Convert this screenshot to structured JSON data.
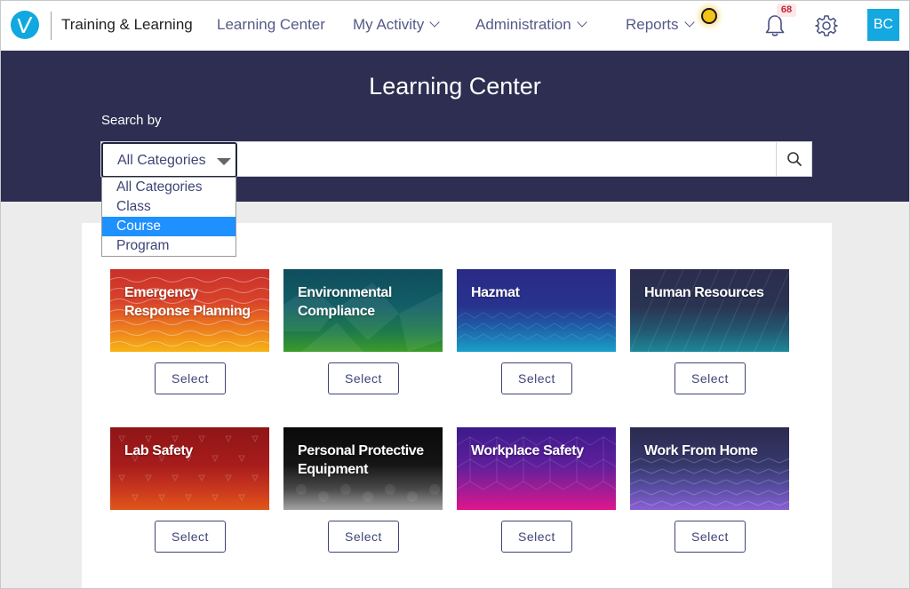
{
  "nav": {
    "app_title": "Training & Learning",
    "links": [
      {
        "label": "Learning Center",
        "has_menu": false
      },
      {
        "label": "My Activity",
        "has_menu": true
      },
      {
        "label": "Administration",
        "has_menu": true
      },
      {
        "label": "Reports",
        "has_menu": true
      }
    ],
    "notification_count": "68",
    "avatar_initials": "BC",
    "icons": [
      "check-logo-icon",
      "bell-icon",
      "gear-icon"
    ]
  },
  "hero": {
    "title": "Learning Center",
    "search_label": "Search by",
    "category_selected": "All Categories",
    "search_value": "",
    "search_icon": "search-icon"
  },
  "dropdown": {
    "options": [
      "All Categories",
      "Class",
      "Course",
      "Program"
    ],
    "highlighted": "Course"
  },
  "cards": [
    {
      "title": "Emergency Response Planning",
      "button": "Select"
    },
    {
      "title": "Environmental Compliance",
      "button": "Select"
    },
    {
      "title": "Hazmat",
      "button": "Select"
    },
    {
      "title": "Human Resources",
      "button": "Select"
    },
    {
      "title": "Lab Safety",
      "button": "Select"
    },
    {
      "title": "Personal Protective Equipment",
      "button": "Select"
    },
    {
      "title": "Workplace Safety",
      "button": "Select"
    },
    {
      "title": "Work From Home",
      "button": "Select"
    }
  ],
  "colors": {
    "nav_bg": "#ffffff",
    "hero_bg": "#2e2e52",
    "accent": "#14a8e0",
    "link": "#555a88",
    "highlight": "#1e90ff"
  }
}
